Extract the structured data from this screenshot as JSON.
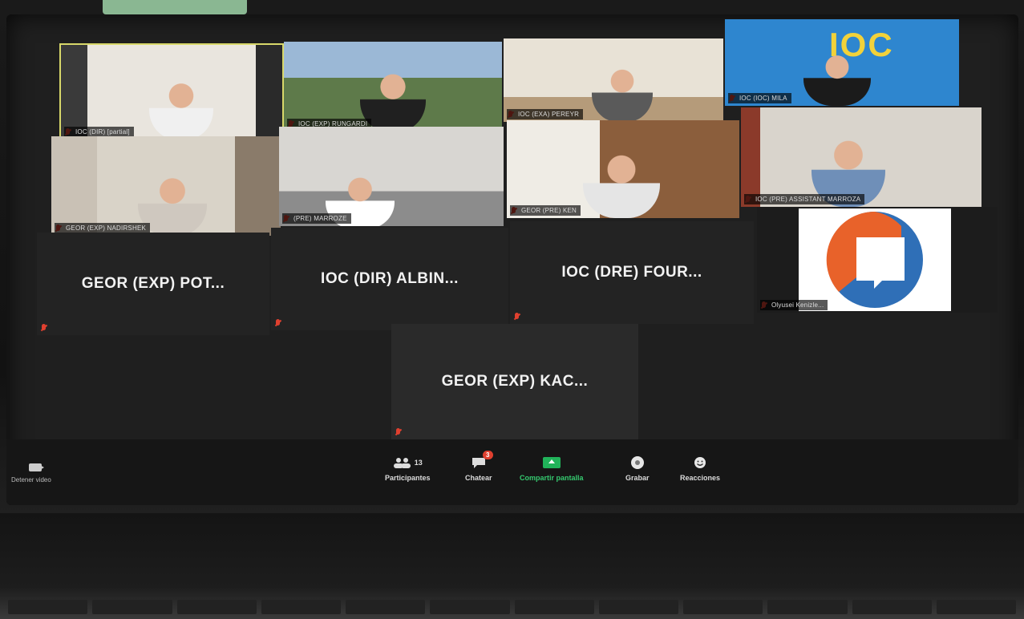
{
  "gallery": {
    "video_tiles": [
      {
        "name": "IOC (DIR) [partial]",
        "active": true
      },
      {
        "name": "IOC (EXP) RUNGARDI"
      },
      {
        "name": "IOC (EXA) PEREYR"
      },
      {
        "name": "IOC (IOC) MILA"
      },
      {
        "name": "GEOR (EXP) NADIRSHEK"
      },
      {
        "name": "(PRE) MARROZE"
      },
      {
        "name": "GEOR (PRE) KEN"
      },
      {
        "name": "IOC (PRE) ASSISTANT MARROZA"
      }
    ],
    "logo_tile_text": "IOC",
    "name_tiles": [
      {
        "name": "GEOR (EXP) POT..."
      },
      {
        "name": "IOC (DIR) ALBIN..."
      },
      {
        "name": "IOC (DRE) FOUR..."
      },
      {
        "name": "GEOR (EXP) KAC..."
      }
    ],
    "avatar_tile_name": "Olyusei Kenizle..."
  },
  "toolbar": {
    "video": {
      "label": "Detener video",
      "icon": "video-camera-icon"
    },
    "participants": {
      "label": "Participantes",
      "count": "13",
      "icon": "participants-icon"
    },
    "chat": {
      "label": "Chatear",
      "badge": "3",
      "icon": "chat-icon"
    },
    "share": {
      "label": "Compartir pantalla",
      "icon": "share-screen-icon",
      "color": "#21b35a"
    },
    "record": {
      "label": "Grabar",
      "icon": "record-icon"
    },
    "reactions": {
      "label": "Reacciones",
      "icon": "reactions-icon"
    }
  },
  "colors": {
    "mute_red": "#e0402f",
    "active_speaker": "#d8d86a",
    "share_green": "#21b35a",
    "ioc_blue": "#2e86cf",
    "ioc_yellow": "#f2d23a",
    "avatar_orange": "#e8622a",
    "avatar_blue": "#2f6fb7"
  }
}
